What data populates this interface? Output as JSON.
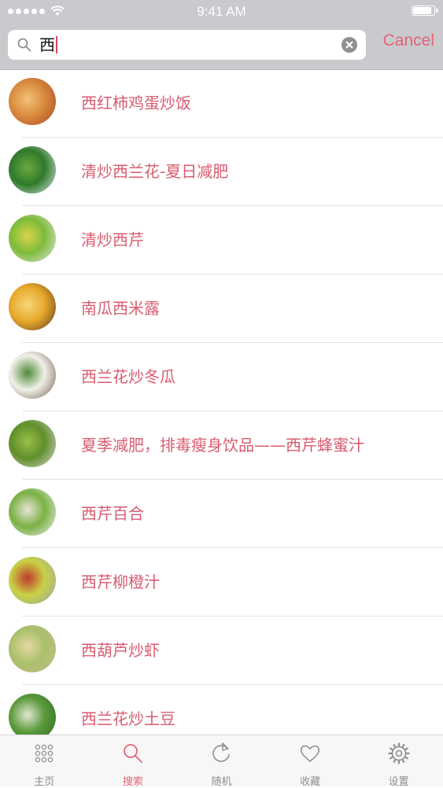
{
  "status_bar": {
    "time": "9:41 AM",
    "battery_level": 0.9
  },
  "search": {
    "query": "西",
    "cancel_label": "Cancel"
  },
  "results": [
    {
      "title": "西红柿鸡蛋炒饭",
      "thumb_colors": [
        "#a8462a",
        "#d88a3c",
        "#f2c27a"
      ]
    },
    {
      "title": "清炒西兰花-夏日减肥",
      "thumb_colors": [
        "#dfe6ec",
        "#2f7a2a",
        "#6fa843"
      ]
    },
    {
      "title": "清炒西芹",
      "thumb_colors": [
        "#e6e9e8",
        "#7dbb3a",
        "#d9d34a"
      ]
    },
    {
      "title": "南瓜西米露",
      "thumb_colors": [
        "#5c3a22",
        "#e8a92c",
        "#f6d77a"
      ]
    },
    {
      "title": "西兰花炒冬瓜",
      "thumb_colors": [
        "#6b5b49",
        "#f0f0e8",
        "#4f8a3a"
      ]
    },
    {
      "title": "夏季减肥，排毒瘦身饮品——西芹蜂蜜汁",
      "thumb_colors": [
        "#d8dad6",
        "#5f8f2a",
        "#9bbf4a"
      ]
    },
    {
      "title": "西芹百合",
      "thumb_colors": [
        "#f1f1ee",
        "#7ab145",
        "#e8e4d6"
      ]
    },
    {
      "title": "西芹柳橙汁",
      "thumb_colors": [
        "#9ca3a8",
        "#c8d246",
        "#c0392b"
      ]
    },
    {
      "title": "西葫芦炒虾",
      "thumb_colors": [
        "#c9b98e",
        "#a9c06a",
        "#e8d7a4"
      ]
    },
    {
      "title": "西兰花炒土豆",
      "thumb_colors": [
        "#2e6a2a",
        "#5b9a3a",
        "#dfe7d3"
      ]
    }
  ],
  "tabs": [
    {
      "label": "主页",
      "icon": "grid-icon",
      "active": false
    },
    {
      "label": "搜索",
      "icon": "search-icon",
      "active": true
    },
    {
      "label": "随机",
      "icon": "refresh-icon",
      "active": false
    },
    {
      "label": "收藏",
      "icon": "heart-icon",
      "active": false
    },
    {
      "label": "设置",
      "icon": "gear-icon",
      "active": false
    }
  ],
  "colors": {
    "accent": "#e26577",
    "item_text": "#d85c6f",
    "tab_inactive": "#8e8e93"
  }
}
